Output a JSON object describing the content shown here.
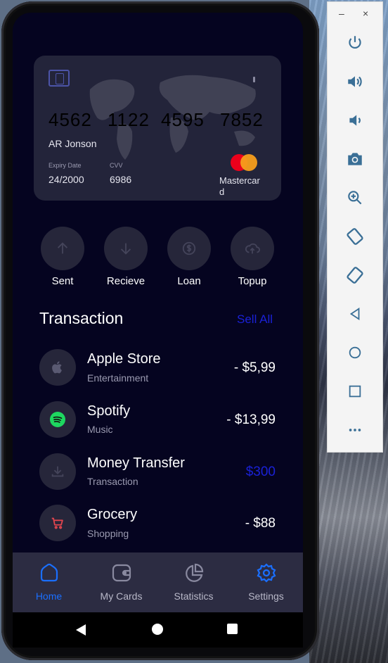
{
  "card": {
    "number_groups": [
      "4562",
      "1122",
      "4595",
      "7852"
    ],
    "holder": "AR Jonson",
    "expiry_label": "Expiry Date",
    "expiry": "24/2000",
    "cvv_label": "CVV",
    "cvv": "6986",
    "brand": "Mastercard"
  },
  "actions": [
    {
      "label": "Sent",
      "icon": "arrow-up-icon"
    },
    {
      "label": "Recieve",
      "icon": "arrow-down-icon"
    },
    {
      "label": "Loan",
      "icon": "dollar-icon"
    },
    {
      "label": "Topup",
      "icon": "cloud-upload-icon"
    }
  ],
  "transactions_section": {
    "title": "Transaction",
    "see_all": "Sell All"
  },
  "transactions": [
    {
      "name": "Apple Store",
      "category": "Entertainment",
      "amount": "- $5,99",
      "icon": "apple-icon"
    },
    {
      "name": "Spotify",
      "category": "Music",
      "amount": "- $13,99",
      "icon": "spotify-icon"
    },
    {
      "name": "Money Transfer",
      "category": "Transaction",
      "amount": "$300",
      "icon": "download-icon"
    },
    {
      "name": "Grocery",
      "category": "Shopping",
      "amount": "- $88",
      "icon": "cart-icon"
    }
  ],
  "bottom_nav": [
    {
      "label": "Home",
      "icon": "home-icon",
      "active": true
    },
    {
      "label": "My Cards",
      "icon": "wallet-icon",
      "active": false
    },
    {
      "label": "Statistics",
      "icon": "pie-chart-icon",
      "active": false
    },
    {
      "label": "Settings",
      "icon": "gear-icon",
      "active": false
    }
  ],
  "emulator_toolbar": {
    "items": [
      "power-icon",
      "volume-up-icon",
      "volume-down-icon",
      "camera-icon",
      "zoom-in-icon",
      "rotate-left-icon",
      "rotate-right-icon",
      "back-icon",
      "home-circle-icon",
      "overview-icon",
      "more-icon"
    ],
    "minimize": "–",
    "close": "×"
  },
  "colors": {
    "screen_bg": "#050420",
    "card_bg": "#23243a",
    "accent_blue": "#1a21d6",
    "nav_active": "#1a6fff",
    "nav_bg": "#2c2c42",
    "spotify_green": "#1ed760",
    "cart_red": "#e0454e"
  }
}
